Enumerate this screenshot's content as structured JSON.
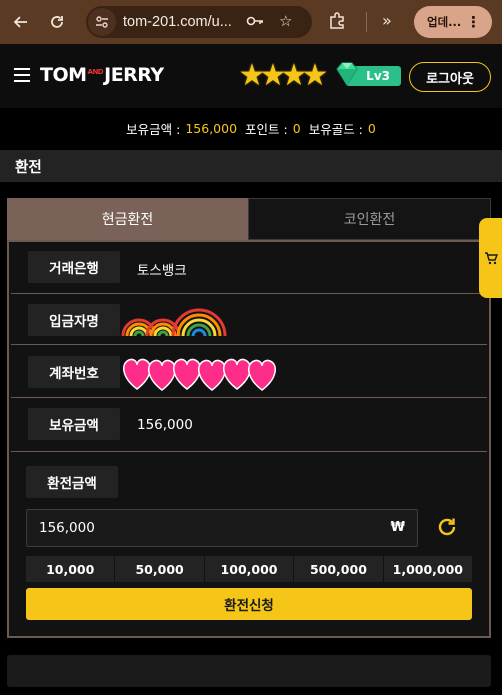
{
  "browser": {
    "url": "tom-201.com/u...",
    "update_label": "업데...",
    "icons": [
      "back-arrow-icon",
      "reload-icon",
      "site-settings-icon",
      "password-key-icon",
      "bookmark-star-icon",
      "extensions-icon",
      "chevron-double-right-icon",
      "kebab-menu-icon"
    ]
  },
  "header": {
    "logo_left": "TOM",
    "logo_and": "AND",
    "logo_right": "JERRY",
    "level": "Lv3",
    "logout_label": "로그아웃",
    "accent_color": "#f5c518",
    "level_color": "#2bbf8a"
  },
  "balance": {
    "money_label": "보유금액 :",
    "money_value": "156,000",
    "point_label": "포인트 :",
    "point_value": "0",
    "gold_label": "보유골드 :",
    "gold_value": "0"
  },
  "page_title": "환전",
  "tabs": [
    {
      "label": "현금환전",
      "active": true
    },
    {
      "label": "코인환전",
      "active": false
    }
  ],
  "form": {
    "bank_label": "거래은행",
    "bank_value": "토스뱅크",
    "depositor_label": "입금자명",
    "account_label": "계좌번호",
    "holding_label": "보유금액",
    "holding_value": "156,000",
    "exchange_label": "환전금액",
    "amount_value": "156,000",
    "currency_symbol": "₩",
    "quick_amounts": [
      "10,000",
      "50,000",
      "100,000",
      "500,000",
      "1,000,000"
    ],
    "submit_label": "환전신청"
  }
}
